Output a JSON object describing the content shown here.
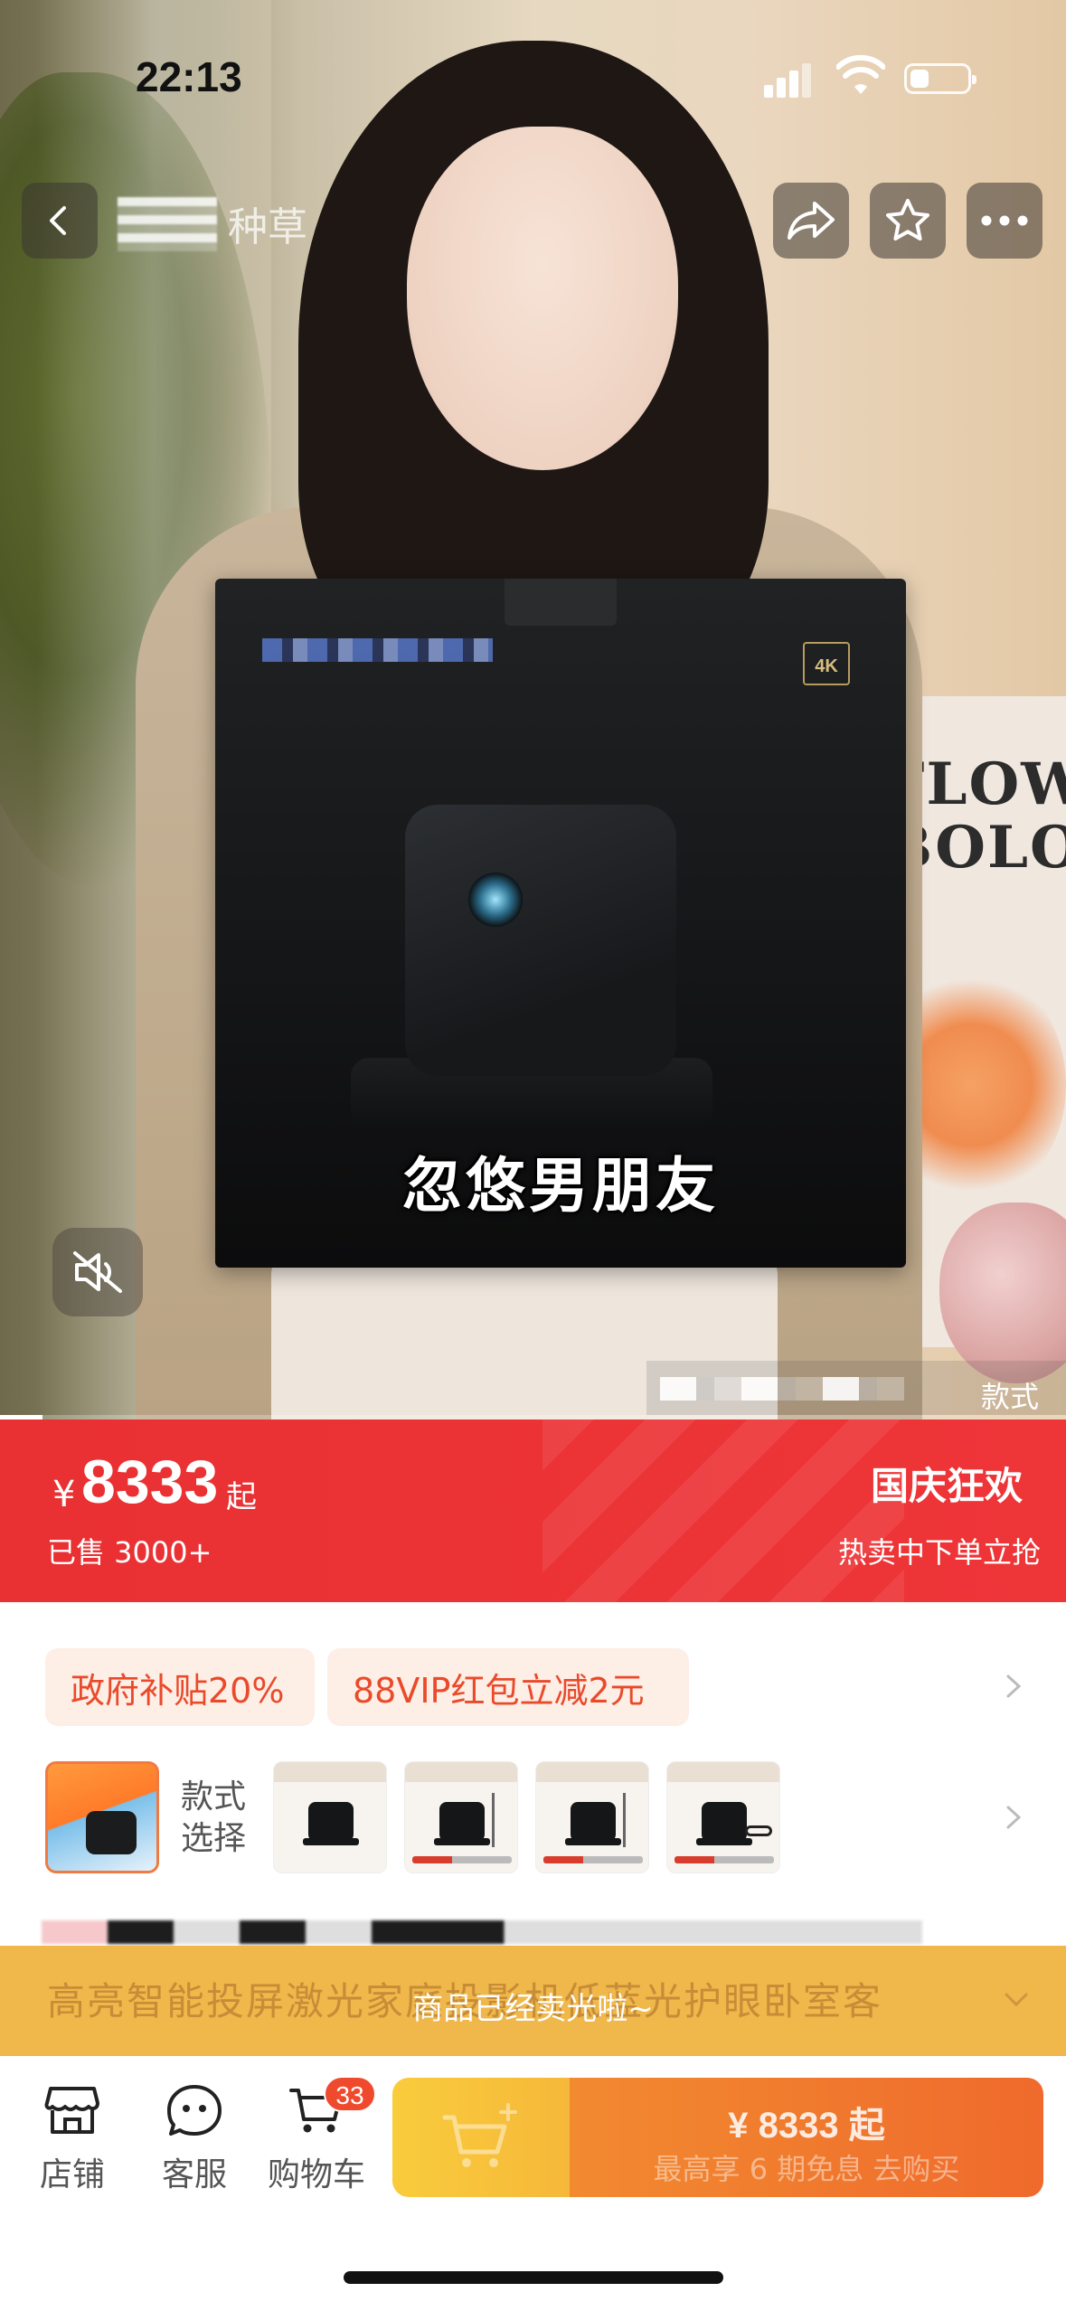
{
  "status_bar": {
    "time": "22:13"
  },
  "top_nav": {
    "tab_label": "种草"
  },
  "media": {
    "caption": "忽悠男朋友",
    "box_badge": "4K",
    "style_label": "款式",
    "progress": 0.04,
    "poster_line1": "FLOW",
    "poster_line2": "BOLOG"
  },
  "price_banner": {
    "currency": "¥",
    "price": "8333",
    "price_suffix": "起",
    "sold": "已售 3000+",
    "promo_title": "国庆狂欢",
    "promo_subtitle": "热卖中下单立抢",
    "color": "#e93032"
  },
  "coupons": [
    "政府补贴20%",
    "88VIP红包立减2元"
  ],
  "variants": {
    "label_line1": "款式",
    "label_line2": "选择",
    "count": 5
  },
  "product": {
    "title": "高亮智能投屏激光家庭投影机低蓝光护眼卧室客",
    "sold_out_notice": "商品已经卖光啦~"
  },
  "action_bar": {
    "store": "店铺",
    "service": "客服",
    "cart": "购物车",
    "cart_count": "33",
    "buy_price": "¥ 8333 起",
    "buy_subtitle": "最高享 6 期免息  去购买"
  },
  "icons": {
    "back": "chevron-left-icon",
    "share": "share-arrow-icon",
    "favorite": "star-icon",
    "more": "more-dots-icon",
    "mute": "speaker-muted-icon",
    "store": "store-icon",
    "service": "chat-face-icon",
    "cart": "cart-icon"
  }
}
